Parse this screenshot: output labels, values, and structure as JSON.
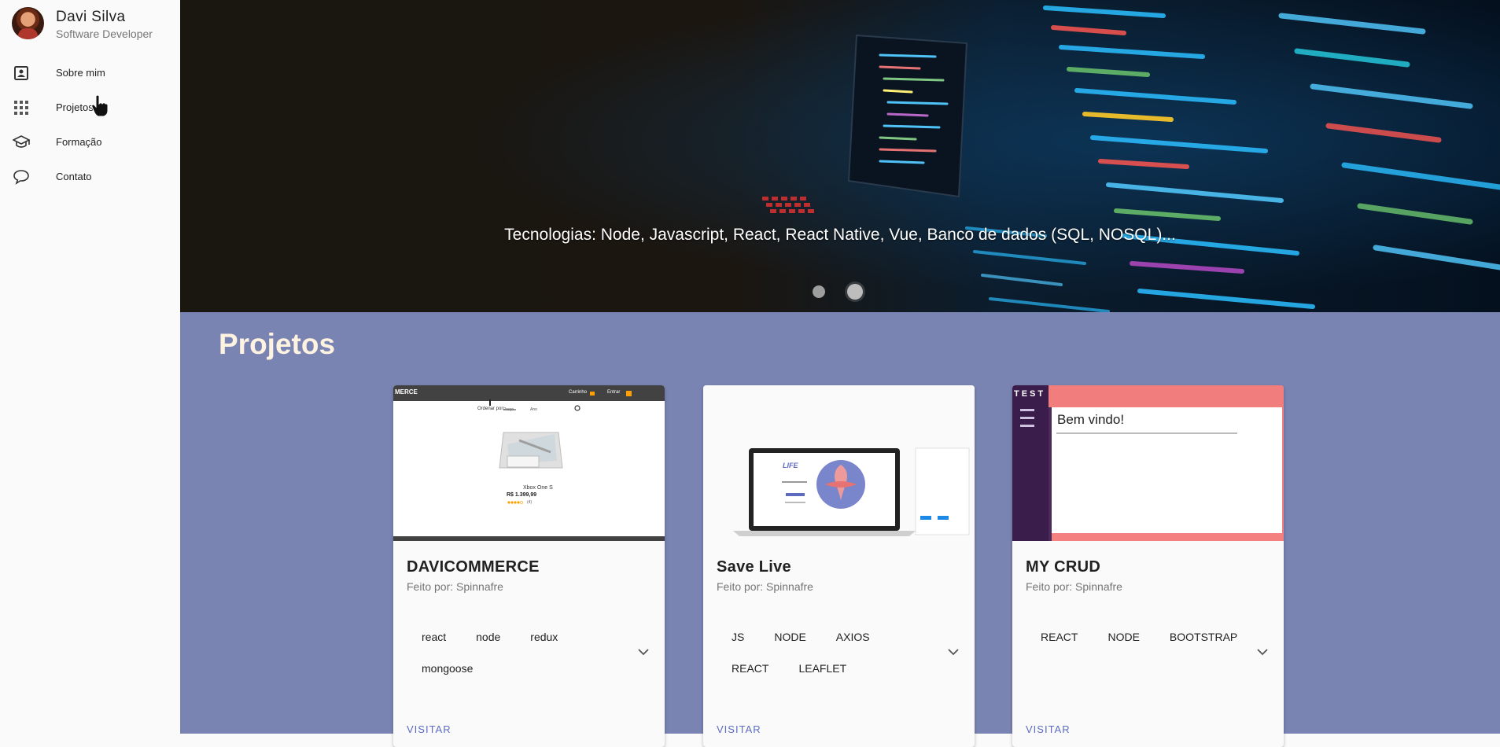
{
  "profile": {
    "name": "Davi Silva",
    "role": "Software Developer"
  },
  "nav": [
    {
      "label": "Sobre mim",
      "icon": "contact-card-icon"
    },
    {
      "label": "Projetos",
      "icon": "grid-apps-icon"
    },
    {
      "label": "Formação",
      "icon": "graduation-cap-icon"
    },
    {
      "label": "Contato",
      "icon": "chat-bubble-icon"
    }
  ],
  "hero": {
    "caption": "Tecnologias: Node, Javascript, React, React Native, Vue, Banco de dados (SQL, NOSQL)...",
    "slides": 2,
    "active_slide": 2
  },
  "projects": {
    "title": "Projetos",
    "cards": [
      {
        "title": "DAVICOMMERCE",
        "subtitle": "Feito por: Spinnafre",
        "tags": [
          "react",
          "node",
          "redux",
          "mongoose"
        ],
        "visit": "VISITAR",
        "thumb": {
          "brand": "MERCE",
          "topbar": [
            "Carrinho",
            "Entrar"
          ],
          "sort_label": "Ordenar por:",
          "sort_a": "Preço",
          "sort_b": "Ano",
          "product_name": "Xbox One S",
          "price": "R$ 1.399,99",
          "reviews": "(4)"
        }
      },
      {
        "title": "Save Live",
        "subtitle": "Feito por: Spinnafre",
        "tags": [
          "JS",
          "NODE",
          "AXIOS",
          "REACT",
          "LEAFLET"
        ],
        "visit": "VISITAR",
        "thumb": {
          "logo": "LIFE"
        }
      },
      {
        "title": "MY CRUD",
        "subtitle": "Feito por: Spinnafre",
        "tags": [
          "REACT",
          "NODE",
          "BOOTSTRAP"
        ],
        "visit": "VISITAR",
        "thumb": {
          "brand": "TEST",
          "heading": "Bem vindo!"
        }
      }
    ]
  },
  "colors": {
    "projects_bg": "#7a84b3",
    "projects_title": "#fdf3e0",
    "link": "#5c6bc0"
  }
}
